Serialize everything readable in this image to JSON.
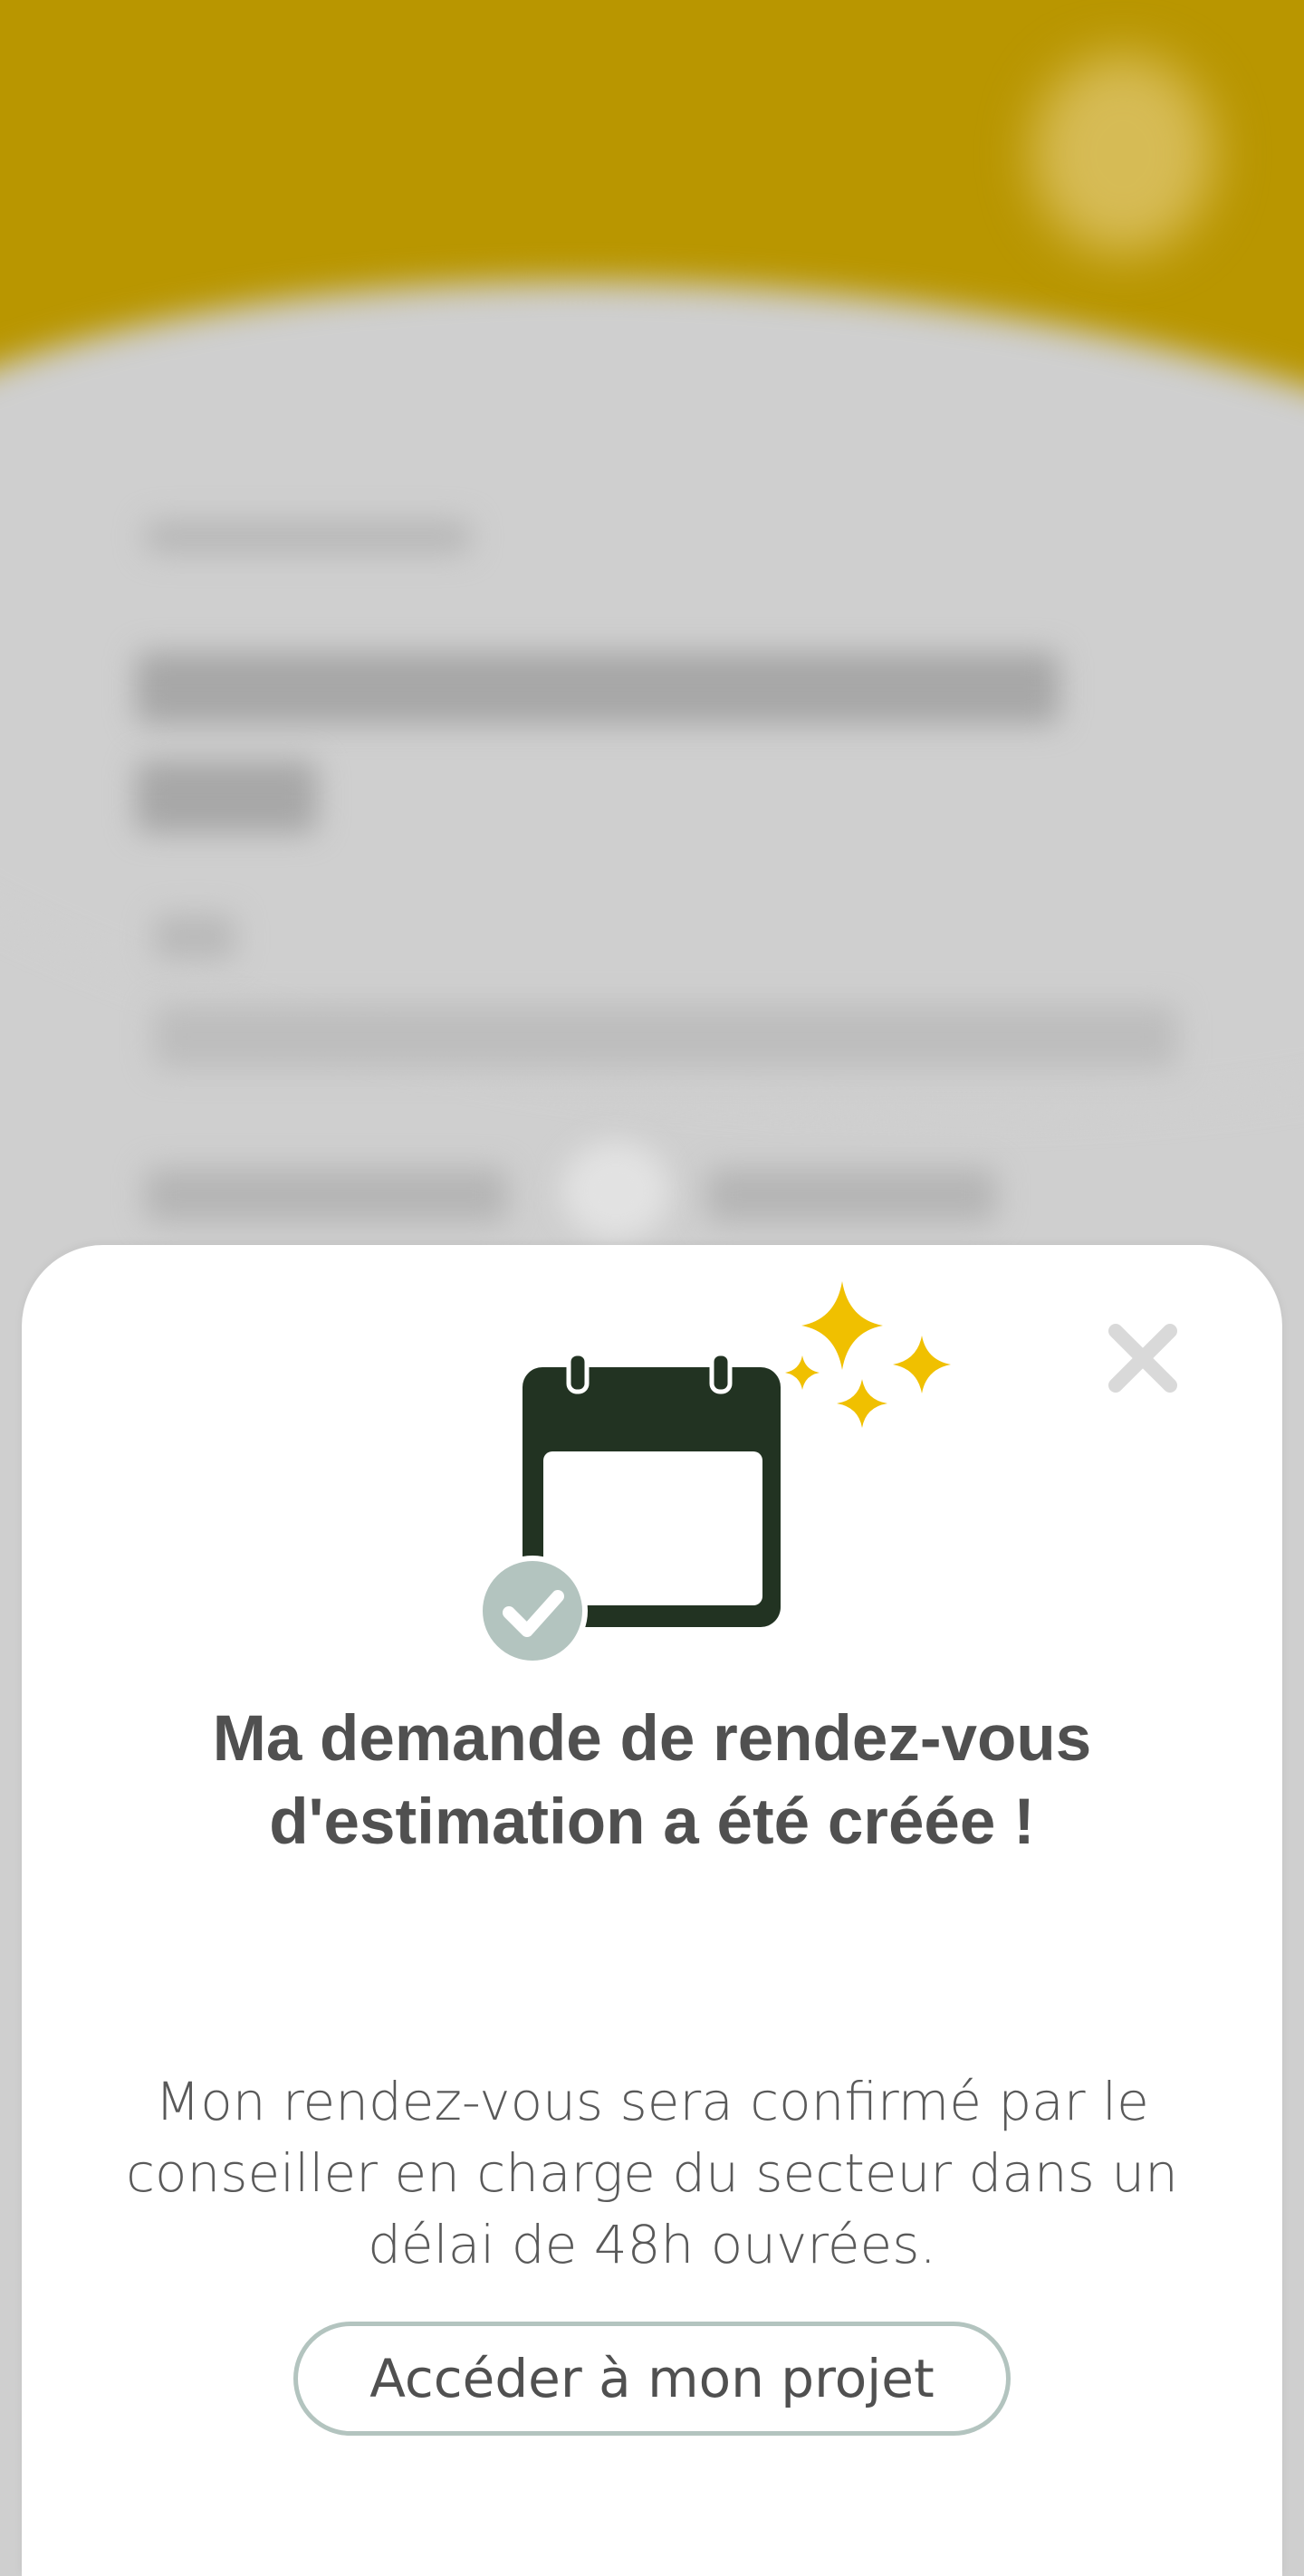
{
  "modal": {
    "title": "Ma demande de rendez-vous d'estimation a été créée !",
    "description": "Mon rendez-vous sera confirmé par le conseiller en charge du secteur dans un délai de 48h ouvrées.",
    "primary_button_label": "Accéder à mon projet",
    "close_icon": "close-icon",
    "illustration_icons": [
      "calendar-icon",
      "check-circle-icon",
      "sparkle-icon"
    ]
  },
  "colors": {
    "header_accent": "#b99600",
    "sparkle": "#f0c000",
    "calendar": "#223322",
    "check_badge": "#b3c4bf",
    "text": "#505050",
    "close": "#d9d9d9"
  }
}
